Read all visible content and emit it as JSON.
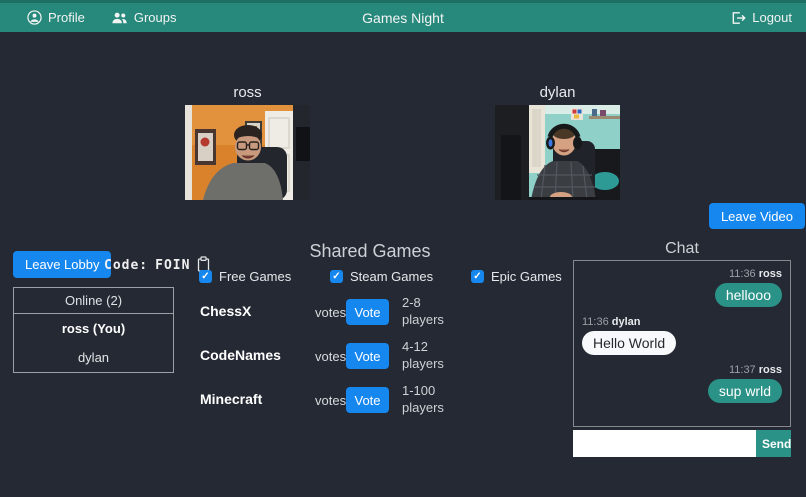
{
  "navbar": {
    "profile_label": "Profile",
    "groups_label": "Groups",
    "brand": "Games Night",
    "logout_label": "Logout"
  },
  "videos": {
    "left_name": "ross",
    "right_name": "dylan"
  },
  "buttons": {
    "leave_video": "Leave Video",
    "leave_lobby": "Leave Lobby",
    "vote": "Vote",
    "send": "Send"
  },
  "lobby": {
    "code_label": "Code:",
    "code_value": "FOIN"
  },
  "online": {
    "header": "Online (2)",
    "members": [
      "ross (You)",
      "dylan"
    ]
  },
  "shared_games": {
    "title": "Shared Games",
    "votes_label": "votes:",
    "filters": [
      {
        "label": "Free Games",
        "checked": true
      },
      {
        "label": "Steam Games",
        "checked": true
      },
      {
        "label": "Epic Games",
        "checked": true
      }
    ],
    "games": [
      {
        "name": "ChessX",
        "players": "2-8 players"
      },
      {
        "name": "CodeNames",
        "players": "4-12 players"
      },
      {
        "name": "Minecraft",
        "players": "1-100 players"
      }
    ]
  },
  "chat": {
    "title": "Chat",
    "messages": [
      {
        "time": "11:36",
        "sender": "ross",
        "text": "hellooo",
        "side": "right"
      },
      {
        "time": "11:36",
        "sender": "dylan",
        "text": "Hello World",
        "side": "left"
      },
      {
        "time": "11:37",
        "sender": "ross",
        "text": "sup wrld",
        "side": "right"
      }
    ],
    "input_value": ""
  },
  "icons": {
    "profile": "person-circle",
    "groups": "people",
    "logout": "box-arrow-right",
    "copy_code": "clipboard"
  },
  "colors": {
    "navbar_teal": "#27897b",
    "accent_blue": "#1787f0",
    "bubble_teal": "#2a9287",
    "background": "#242933"
  }
}
